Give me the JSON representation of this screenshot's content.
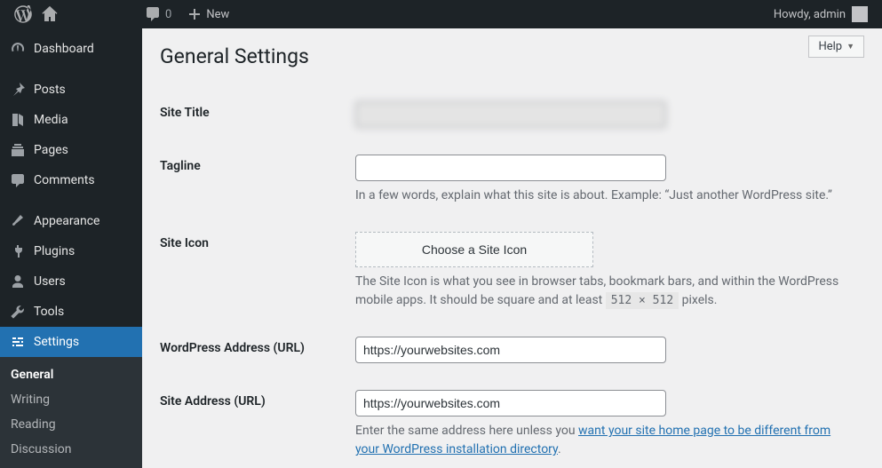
{
  "adminbar": {
    "comments_count": "0",
    "new_label": "New",
    "howdy": "Howdy, admin"
  },
  "help_label": "Help",
  "menu": {
    "dashboard": "Dashboard",
    "posts": "Posts",
    "media": "Media",
    "pages": "Pages",
    "comments": "Comments",
    "appearance": "Appearance",
    "plugins": "Plugins",
    "users": "Users",
    "tools": "Tools",
    "settings": "Settings"
  },
  "submenu": {
    "general": "General",
    "writing": "Writing",
    "reading": "Reading",
    "discussion": "Discussion"
  },
  "page": {
    "title": "General Settings",
    "site_title_label": "Site Title",
    "site_title_value": "REDACTED",
    "tagline_label": "Tagline",
    "tagline_value": "",
    "tagline_desc": "In a few words, explain what this site is about. Example: “Just another WordPress site.”",
    "site_icon_label": "Site Icon",
    "site_icon_button": "Choose a Site Icon",
    "site_icon_desc_a": "The Site Icon is what you see in browser tabs, bookmark bars, and within the WordPress mobile apps. It should be square and at least ",
    "site_icon_code": "512 × 512",
    "site_icon_desc_b": " pixels.",
    "wp_url_label": "WordPress Address (URL)",
    "wp_url_value": "https://yourwebsites.com",
    "site_url_label": "Site Address (URL)",
    "site_url_value": "https://yourwebsites.com",
    "site_url_desc_a": "Enter the same address here unless you ",
    "site_url_link": "want your site home page to be different from your WordPress installation directory",
    "site_url_desc_b": "."
  }
}
